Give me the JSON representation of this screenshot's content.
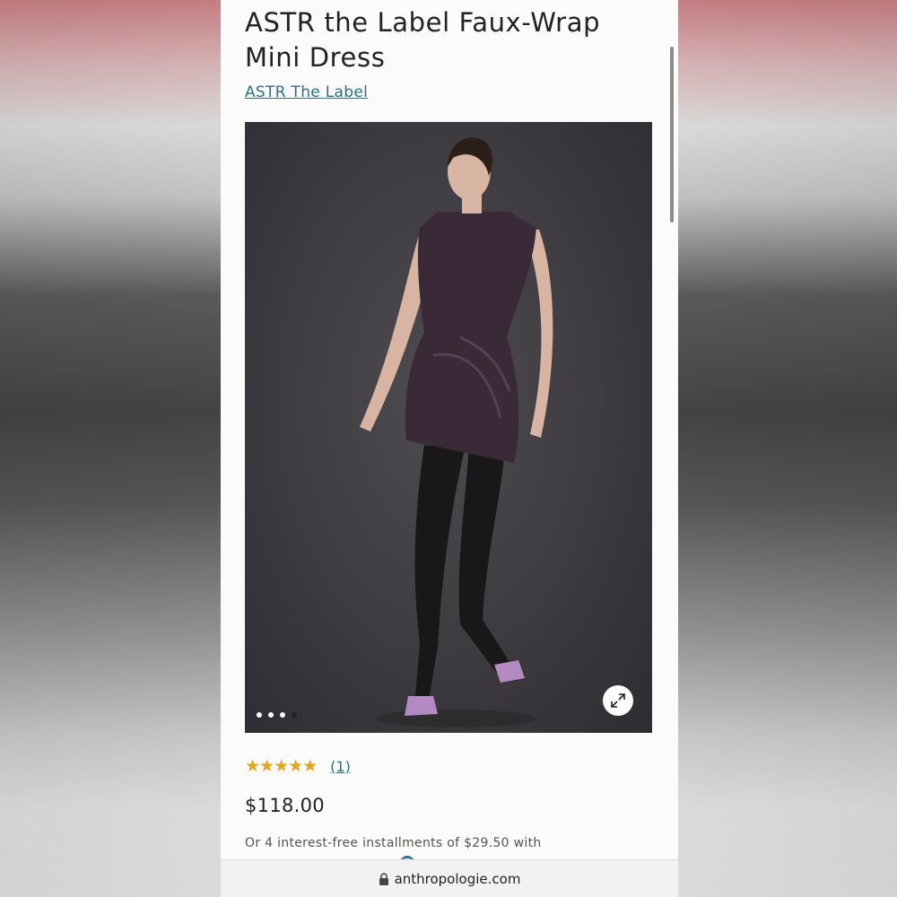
{
  "product": {
    "title": "ASTR the Label Faux-Wrap Mini Dress",
    "brand": "ASTR The Label",
    "rating": {
      "stars": 5,
      "star_glyphs": "★★★★★",
      "count_label": "(1)"
    },
    "price": "$118.00",
    "installments": "Or 4 interest-free installments of $29.50 with"
  },
  "gallery": {
    "total_images": 4,
    "active_index": 4,
    "expand_icon": "expand-icon"
  },
  "browser": {
    "lock_icon": "lock-icon",
    "url": "anthropologie.com"
  }
}
